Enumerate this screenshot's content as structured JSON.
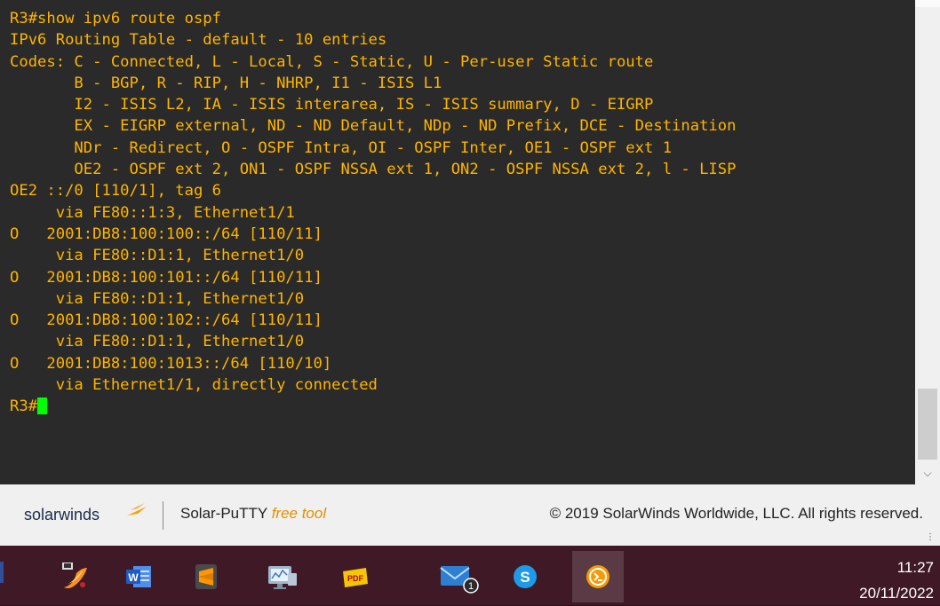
{
  "terminal": {
    "lines": [
      "R3#show ipv6 route ospf",
      "IPv6 Routing Table - default - 10 entries",
      "Codes: C - Connected, L - Local, S - Static, U - Per-user Static route",
      "       B - BGP, R - RIP, H - NHRP, I1 - ISIS L1",
      "       I2 - ISIS L2, IA - ISIS interarea, IS - ISIS summary, D - EIGRP",
      "       EX - EIGRP external, ND - ND Default, NDp - ND Prefix, DCE - Destination",
      "       NDr - Redirect, O - OSPF Intra, OI - OSPF Inter, OE1 - OSPF ext 1",
      "       OE2 - OSPF ext 2, ON1 - OSPF NSSA ext 1, ON2 - OSPF NSSA ext 2, l - LISP",
      "OE2 ::/0 [110/1], tag 6",
      "     via FE80::1:3, Ethernet1/1",
      "O   2001:DB8:100:100::/64 [110/11]",
      "     via FE80::D1:1, Ethernet1/0",
      "O   2001:DB8:100:101::/64 [110/11]",
      "     via FE80::D1:1, Ethernet1/0",
      "O   2001:DB8:100:102::/64 [110/11]",
      "     via FE80::D1:1, Ethernet1/0",
      "O   2001:DB8:100:1013::/64 [110/10]",
      "     via Ethernet1/1, directly connected"
    ],
    "prompt": "R3#",
    "text_color": "#ffb400",
    "cursor_color": "#00ff00",
    "background": "#2a2a2a"
  },
  "footer": {
    "brand": "solarwinds",
    "product": "Solar-PuTTY",
    "free_label": "free tool",
    "copyright": "© 2019 SolarWinds Worldwide, LLC. All rights reserved."
  },
  "taskbar": {
    "apps": [
      {
        "icon": "gns3-icon"
      },
      {
        "icon": "word-icon"
      },
      {
        "icon": "sublime-text-icon"
      },
      {
        "icon": "network-monitor-icon"
      },
      {
        "icon": "pdf-reader-icon"
      },
      {
        "icon": "mail-icon",
        "badge": "1"
      },
      {
        "icon": "skype-icon"
      },
      {
        "icon": "solar-putty-icon",
        "active": true
      }
    ],
    "time": "11:27",
    "date": "20/11/2022"
  }
}
